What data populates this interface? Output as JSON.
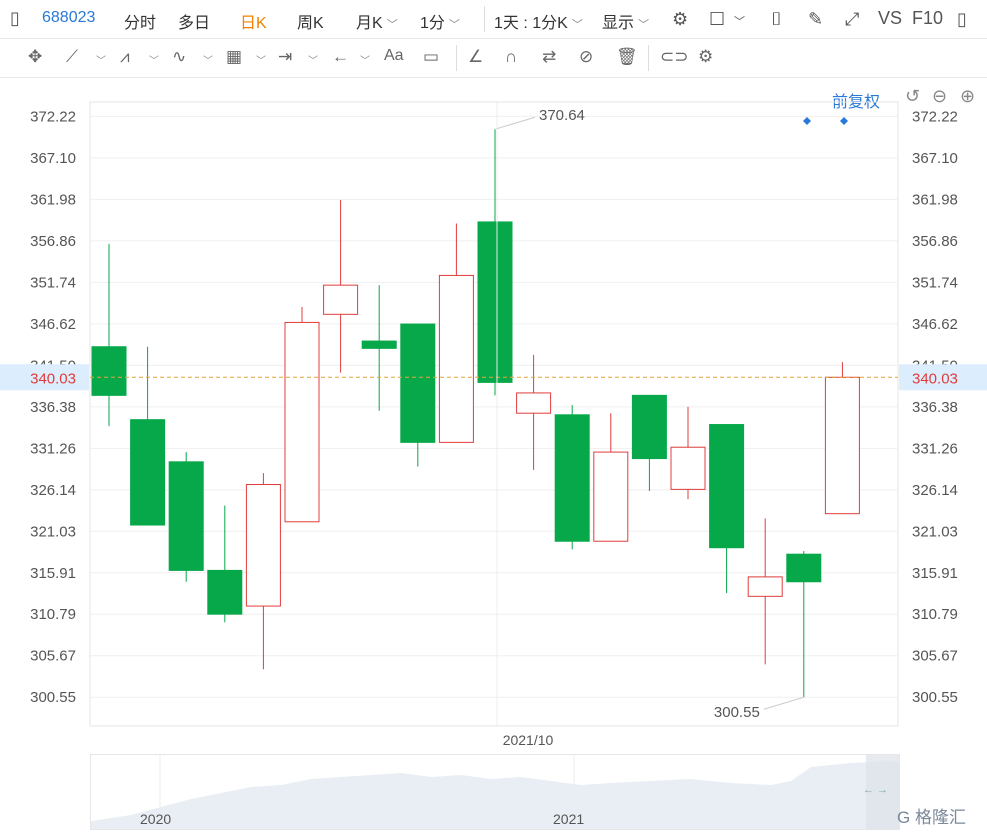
{
  "toolbar": {
    "code": "688023",
    "tabs": [
      "分时",
      "多日",
      "日K",
      "周K",
      "月K",
      "1分"
    ],
    "active_tab": "日K",
    "period": "1天 : 1分K",
    "display": "显示",
    "vs": "VS",
    "f10": "F10"
  },
  "adjust_label": "前复权",
  "colors": {
    "up": "#e03c3c",
    "down": "#06a84a",
    "current_line": "#e2a33d",
    "label_bg": "#dceefd"
  },
  "chart_data": {
    "type": "candlestick",
    "current_price": "340.03",
    "ylim": [
      297,
      374
    ],
    "y_ticks": [
      "372.22",
      "367.10",
      "361.98",
      "356.86",
      "351.74",
      "346.62",
      "341.50",
      "336.38",
      "331.26",
      "326.14",
      "321.03",
      "315.91",
      "310.79",
      "305.67",
      "300.55"
    ],
    "x_tick_label": "2021/10",
    "high_label": "370.64",
    "low_label": "300.55",
    "candles": [
      {
        "o": 343.8,
        "c": 337.8,
        "h": 356.5,
        "l": 334.0
      },
      {
        "o": 334.8,
        "c": 321.8,
        "h": 343.8,
        "l": 321.8
      },
      {
        "o": 329.6,
        "c": 316.2,
        "h": 330.8,
        "l": 314.8
      },
      {
        "o": 316.2,
        "c": 310.8,
        "h": 324.2,
        "l": 309.8
      },
      {
        "o": 311.8,
        "c": 326.8,
        "h": 328.2,
        "l": 304.0
      },
      {
        "o": 322.2,
        "c": 346.8,
        "h": 348.7,
        "l": 322.2
      },
      {
        "o": 347.8,
        "c": 351.4,
        "h": 361.9,
        "l": 340.6
      },
      {
        "o": 344.5,
        "c": 343.6,
        "h": 351.4,
        "l": 335.9
      },
      {
        "o": 346.6,
        "c": 332.0,
        "h": 346.6,
        "l": 329.0
      },
      {
        "o": 332.0,
        "c": 352.6,
        "h": 359.0,
        "l": 332.0
      },
      {
        "o": 359.2,
        "c": 339.4,
        "h": 370.64,
        "l": 337.8
      },
      {
        "o": 335.6,
        "c": 338.1,
        "h": 342.8,
        "l": 328.6
      },
      {
        "o": 335.4,
        "c": 319.8,
        "h": 336.6,
        "l": 318.8
      },
      {
        "o": 319.8,
        "c": 330.8,
        "h": 335.6,
        "l": 319.8
      },
      {
        "o": 337.8,
        "c": 330.0,
        "h": 337.8,
        "l": 326.0
      },
      {
        "o": 326.2,
        "c": 331.4,
        "h": 336.4,
        "l": 325.0
      },
      {
        "o": 334.2,
        "c": 319.0,
        "h": 334.2,
        "l": 313.4
      },
      {
        "o": 313.0,
        "c": 315.4,
        "h": 322.6,
        "l": 304.6
      },
      {
        "o": 318.2,
        "c": 314.8,
        "h": 318.6,
        "l": 300.55
      },
      {
        "o": 323.2,
        "c": 340.03,
        "h": 341.9,
        "l": 323.2
      }
    ]
  },
  "navigator": {
    "labels": [
      "2020",
      "2021"
    ],
    "arrows": "← →",
    "watermark": "G 格隆汇"
  }
}
